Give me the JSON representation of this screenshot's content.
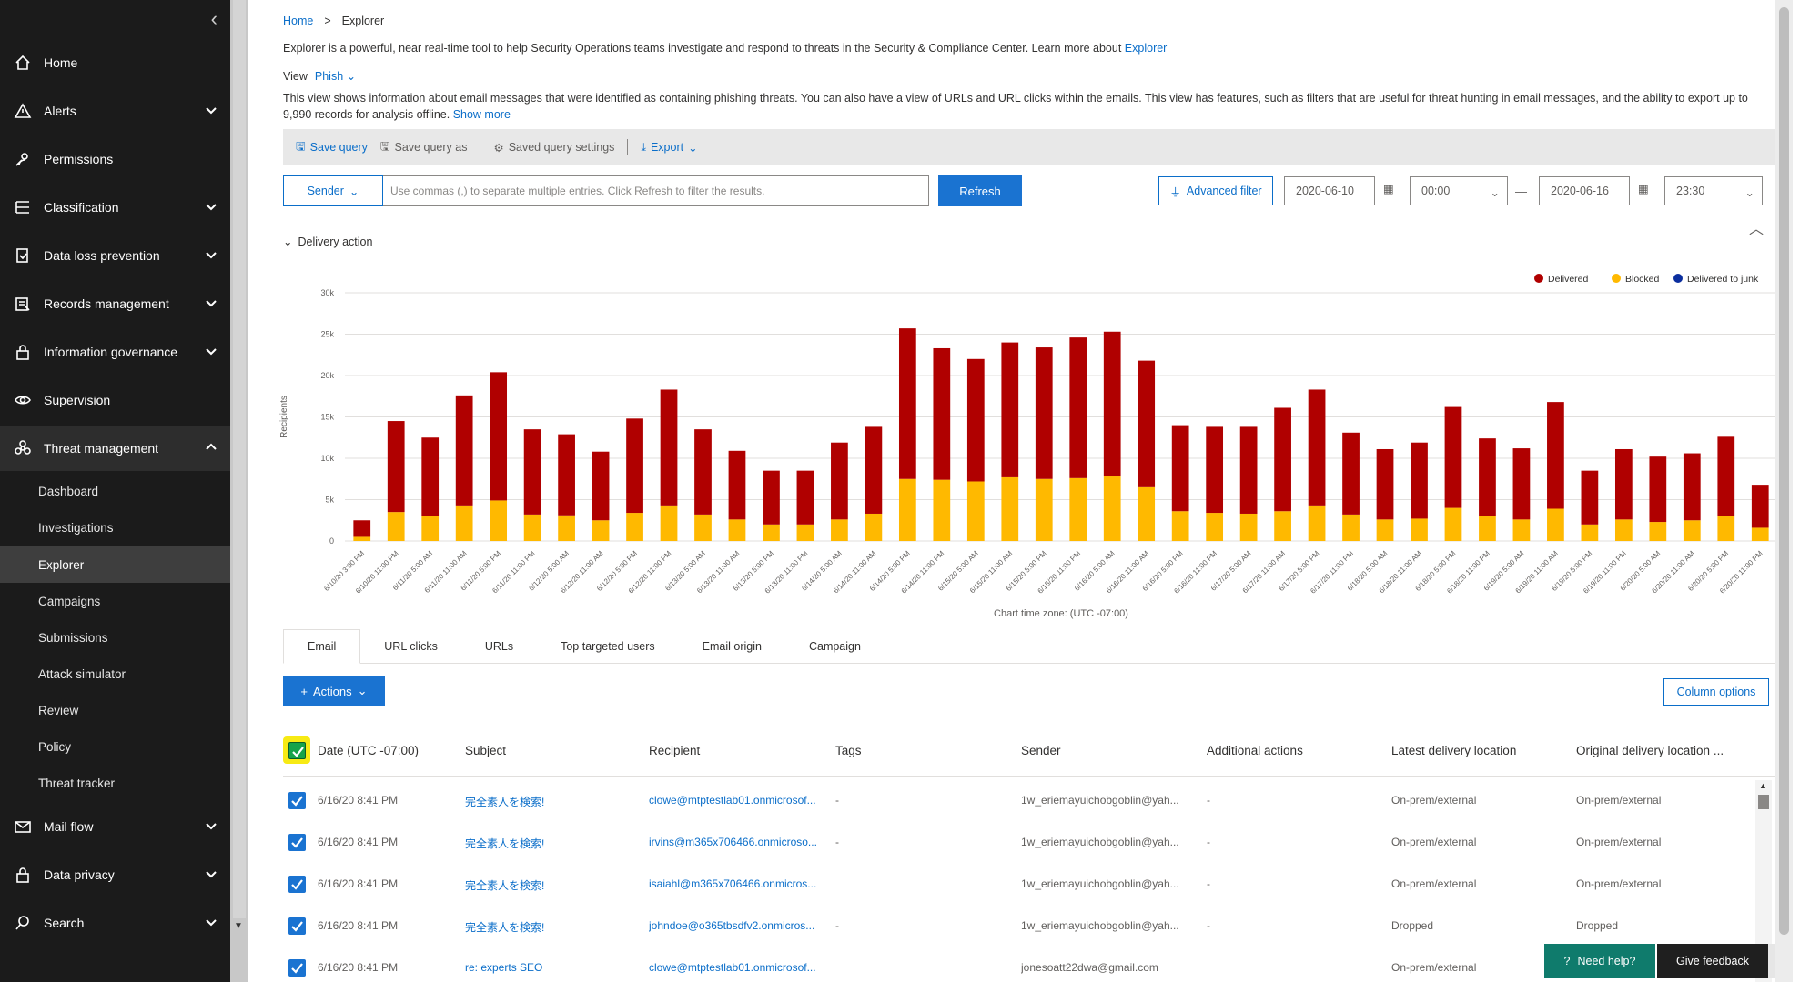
{
  "sidebar": {
    "items": [
      {
        "label": "Home",
        "icon": "home-icon"
      },
      {
        "label": "Alerts",
        "icon": "alert-icon"
      },
      {
        "label": "Permissions",
        "icon": "permissions-icon"
      },
      {
        "label": "Classification",
        "icon": "classification-icon"
      },
      {
        "label": "Data loss prevention",
        "icon": "dlp-icon"
      },
      {
        "label": "Records management",
        "icon": "records-icon"
      },
      {
        "label": "Information governance",
        "icon": "lock-icon"
      },
      {
        "label": "Supervision",
        "icon": "eye-icon"
      },
      {
        "label": "Threat management",
        "icon": "biohazard-icon"
      }
    ],
    "sub_items": [
      "Dashboard",
      "Investigations",
      "Explorer",
      "Campaigns",
      "Submissions",
      "Attack simulator",
      "Review",
      "Policy",
      "Threat tracker"
    ],
    "bottom_items": [
      {
        "label": "Mail flow",
        "icon": "mail-icon"
      },
      {
        "label": "Data privacy",
        "icon": "lock-icon"
      },
      {
        "label": "Search",
        "icon": "search-icon"
      }
    ]
  },
  "breadcrumb": {
    "home": "Home",
    "sep": ">",
    "current": "Explorer"
  },
  "intro": {
    "text": "Explorer is a powerful, near real-time tool to help Security Operations teams investigate and respond to threats in the Security & Compliance Center. Learn more about ",
    "link": "Explorer"
  },
  "view": {
    "label": "View",
    "value": "Phish"
  },
  "description": {
    "text": "This view shows information about email messages that were identified as containing phishing threats. You can also have a view of URLs and URL clicks within the emails. This view has features, such as filters that are useful for threat hunting in email messages, and the ability to export up to 9,990 records for analysis offline.",
    "show_more": "Show more"
  },
  "toolbar": {
    "save_query": "Save query",
    "save_query_as": "Save query as",
    "saved_query_settings": "Saved query settings",
    "export": "Export"
  },
  "filter": {
    "field": "Sender",
    "placeholder": "Use commas (,) to separate multiple entries. Click Refresh to filter the results.",
    "refresh": "Refresh",
    "advanced": "Advanced filter",
    "start_date": "2020-06-10",
    "start_time": "00:00",
    "dash": "—",
    "end_date": "2020-06-16",
    "end_time": "23:30"
  },
  "delivery_header": "Delivery action",
  "colors": {
    "delivered": "#b00000",
    "blocked": "#ffb900",
    "junk": "#0b2e9e",
    "accent": "#1a73d1"
  },
  "chart_data": {
    "type": "bar",
    "stacked": true,
    "ylabel": "Recipients",
    "xlabel": "Chart time zone: (UTC -07:00)",
    "ylim": [
      0,
      30000
    ],
    "yticks": [
      "0",
      "5k",
      "10k",
      "15k",
      "20k",
      "25k",
      "30k"
    ],
    "legend_position": "top-right",
    "grid": true,
    "categories": [
      "6/10/20 3:00 PM",
      "6/10/20 11:00 PM",
      "6/11/20 5:00 AM",
      "6/11/20 11:00 AM",
      "6/11/20 5:00 PM",
      "6/11/20 11:00 PM",
      "6/12/20 5:00 AM",
      "6/12/20 11:00 AM",
      "6/12/20 5:00 PM",
      "6/12/20 11:00 PM",
      "6/13/20 5:00 AM",
      "6/13/20 11:00 AM",
      "6/13/20 5:00 PM",
      "6/13/20 11:00 PM",
      "6/14/20 5:00 AM",
      "6/14/20 11:00 AM",
      "6/14/20 5:00 PM",
      "6/14/20 11:00 PM",
      "6/15/20 5:00 AM",
      "6/15/20 11:00 AM",
      "6/15/20 5:00 PM",
      "6/15/20 11:00 PM",
      "6/16/20 5:00 AM",
      "6/16/20 11:00 AM",
      "6/16/20 5:00 PM",
      "6/16/20 11:00 PM",
      "6/17/20 5:00 AM",
      "6/17/20 11:00 AM",
      "6/17/20 5:00 PM",
      "6/17/20 11:00 PM",
      "6/18/20 5:00 AM",
      "6/18/20 11:00 AM",
      "6/18/20 5:00 PM",
      "6/18/20 11:00 PM",
      "6/19/20 5:00 AM",
      "6/19/20 11:00 AM",
      "6/19/20 5:00 PM",
      "6/19/20 11:00 PM",
      "6/20/20 5:00 AM",
      "6/20/20 11:00 AM",
      "6/20/20 5:00 PM",
      "6/20/20 11:00 PM"
    ],
    "series": [
      {
        "name": "Blocked",
        "color": "#ffb900",
        "values": [
          500,
          3500,
          3000,
          4300,
          4900,
          3200,
          3100,
          2500,
          3400,
          4300,
          3200,
          2600,
          2000,
          2000,
          2600,
          3300,
          7500,
          7400,
          7200,
          7700,
          7500,
          7600,
          7800,
          6500,
          3600,
          3400,
          3300,
          3600,
          4300,
          3200,
          2600,
          2700,
          4000,
          3000,
          2600,
          3900,
          2000,
          2600,
          2300,
          2500,
          3000,
          1600
        ]
      },
      {
        "name": "Delivered",
        "color": "#b00000",
        "values": [
          2000,
          11000,
          9500,
          13300,
          15500,
          10300,
          9800,
          8300,
          11400,
          14000,
          10300,
          8300,
          6500,
          6500,
          9300,
          10500,
          18200,
          15900,
          14800,
          16300,
          15900,
          17000,
          17500,
          15300,
          10400,
          10400,
          10500,
          12500,
          14000,
          9900,
          8500,
          9200,
          12200,
          9400,
          8600,
          12900,
          6500,
          8500,
          7900,
          8100,
          9600,
          5200
        ]
      },
      {
        "name": "Delivered to junk",
        "color": "#0b2e9e",
        "values": [
          0,
          0,
          0,
          0,
          0,
          0,
          0,
          0,
          0,
          0,
          0,
          0,
          0,
          0,
          0,
          0,
          0,
          0,
          0,
          0,
          0,
          0,
          0,
          0,
          0,
          0,
          0,
          0,
          0,
          0,
          0,
          0,
          0,
          0,
          0,
          0,
          0,
          0,
          0,
          0,
          0,
          0
        ]
      }
    ]
  },
  "tabs": [
    "Email",
    "URL clicks",
    "URLs",
    "Top targeted users",
    "Email origin",
    "Campaign"
  ],
  "actions": {
    "actions": "Actions",
    "column_options": "Column options"
  },
  "table": {
    "headers": [
      "Date (UTC -07:00)",
      "Subject",
      "Recipient",
      "Tags",
      "Sender",
      "Additional actions",
      "Latest delivery location",
      "Original delivery location ..."
    ],
    "rows": [
      {
        "date": "6/16/20 8:41 PM",
        "subject": "完全素人を検索!",
        "recipient": "clowe@mtptestlab01.onmicrosof...",
        "tags": "-",
        "sender": "1w_eriemayuichobgoblin@yah...",
        "additional": "-",
        "latest": "On-prem/external",
        "original": "On-prem/external"
      },
      {
        "date": "6/16/20 8:41 PM",
        "subject": "完全素人を検索!",
        "recipient": "irvins@m365x706466.onmicroso...",
        "tags": "-",
        "sender": "1w_eriemayuichobgoblin@yah...",
        "additional": "-",
        "latest": "On-prem/external",
        "original": "On-prem/external"
      },
      {
        "date": "6/16/20 8:41 PM",
        "subject": "完全素人を検索!",
        "recipient": "isaiahl@m365x706466.onmicros...",
        "tags": "",
        "sender": "1w_eriemayuichobgoblin@yah...",
        "additional": "-",
        "latest": "On-prem/external",
        "original": "On-prem/external"
      },
      {
        "date": "6/16/20 8:41 PM",
        "subject": "完全素人を検索!",
        "recipient": "johndoe@o365tbsdfv2.onmicros...",
        "tags": "-",
        "sender": "1w_eriemayuichobgoblin@yah...",
        "additional": "-",
        "latest": "Dropped",
        "original": "Dropped"
      },
      {
        "date": "6/16/20 8:41 PM",
        "subject": "re: experts SEO",
        "recipient": "clowe@mtptestlab01.onmicrosof...",
        "tags": "",
        "sender": "jonesoatt22dwa@gmail.com",
        "additional": "",
        "latest": "On-prem/external",
        "original": ""
      }
    ]
  },
  "help": {
    "need_help": "Need help?",
    "give_feedback": "Give feedback"
  }
}
